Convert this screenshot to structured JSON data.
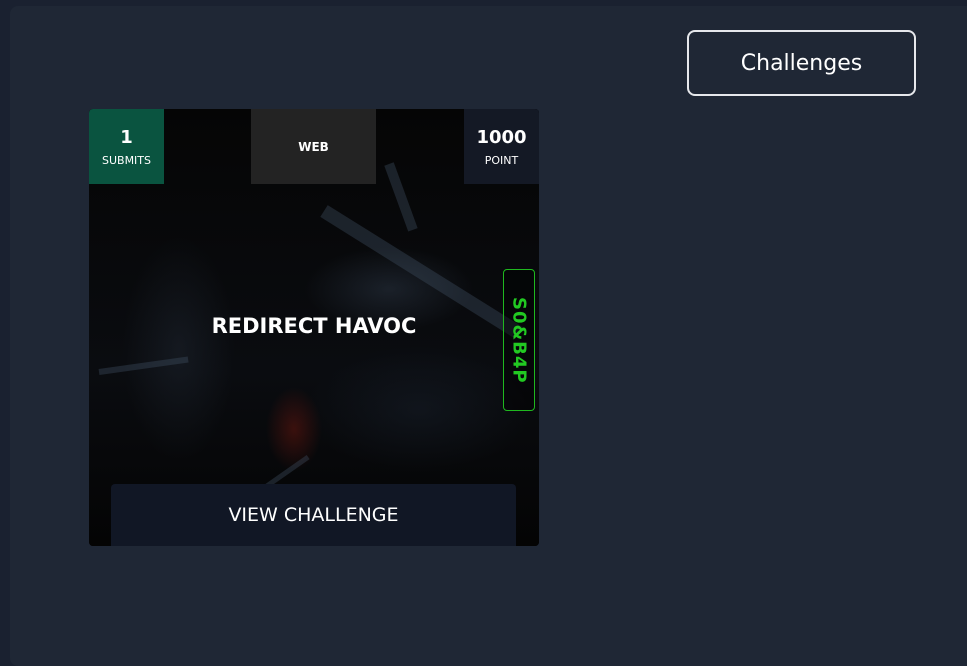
{
  "header": {
    "challenges_button_label": "Challenges"
  },
  "challenge_card": {
    "submits_count": "1",
    "submits_label": "SUBMITS",
    "category": "WEB",
    "points": "1000",
    "points_label": "POINT",
    "title": "REDIRECT HAVOC",
    "author": "S0&B4P",
    "view_button_label": "VIEW CHALLENGE"
  },
  "colors": {
    "background": "#1f2735",
    "submits_badge": "#0a5440",
    "author_accent": "#22c922"
  }
}
